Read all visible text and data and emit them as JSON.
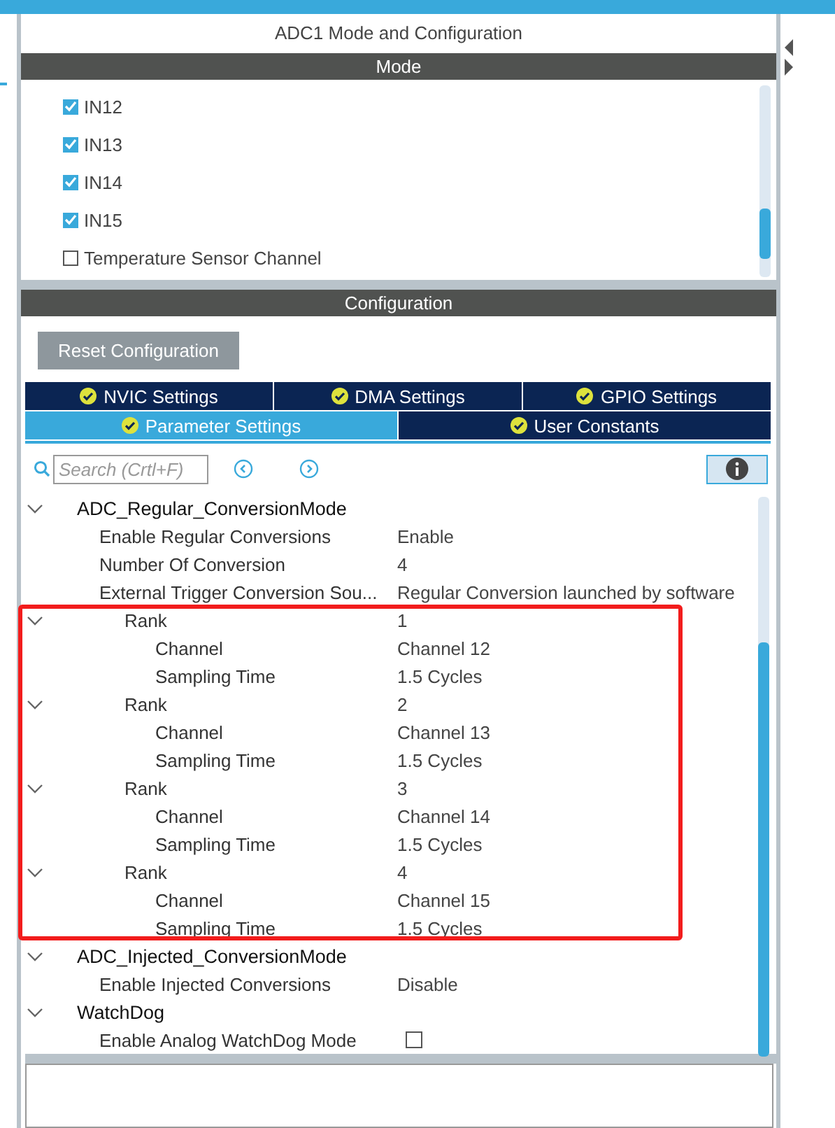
{
  "panel_title": "ADC1 Mode and Configuration",
  "mode": {
    "header": "Mode",
    "items": [
      {
        "label": "IN12",
        "checked": true
      },
      {
        "label": "IN13",
        "checked": true
      },
      {
        "label": "IN14",
        "checked": true
      },
      {
        "label": "IN15",
        "checked": true
      },
      {
        "label": "Temperature Sensor Channel",
        "checked": false
      }
    ]
  },
  "configuration": {
    "header": "Configuration",
    "reset_button": "Reset Configuration",
    "tab_rows": [
      [
        {
          "label": "NVIC Settings",
          "selected": false
        },
        {
          "label": "DMA Settings",
          "selected": false
        },
        {
          "label": "GPIO Settings",
          "selected": false
        }
      ],
      [
        {
          "label": "Parameter Settings",
          "selected": true
        },
        {
          "label": "User Constants",
          "selected": false
        }
      ]
    ],
    "search": {
      "placeholder": "Search (Crtl+F)"
    },
    "tree": [
      {
        "label": "ADC_Regular_ConversionMode",
        "expanded": true,
        "children": [
          {
            "label": "Enable Regular Conversions",
            "value": "Enable"
          },
          {
            "label": "Number Of Conversion",
            "value": "4"
          },
          {
            "label": "External Trigger Conversion Sou...",
            "value": "Regular Conversion launched by software"
          },
          {
            "label": "Rank",
            "value": "1",
            "expanded": true,
            "children": [
              {
                "label": "Channel",
                "value": "Channel 12"
              },
              {
                "label": "Sampling Time",
                "value": "1.5 Cycles"
              }
            ]
          },
          {
            "label": "Rank",
            "value": "2",
            "expanded": true,
            "children": [
              {
                "label": "Channel",
                "value": "Channel 13"
              },
              {
                "label": "Sampling Time",
                "value": "1.5 Cycles"
              }
            ]
          },
          {
            "label": "Rank",
            "value": "3",
            "expanded": true,
            "children": [
              {
                "label": "Channel",
                "value": "Channel 14"
              },
              {
                "label": "Sampling Time",
                "value": "1.5 Cycles"
              }
            ]
          },
          {
            "label": "Rank",
            "value": "4",
            "expanded": true,
            "children": [
              {
                "label": "Channel",
                "value": "Channel 15"
              },
              {
                "label": "Sampling Time",
                "value": "1.5 Cycles"
              }
            ]
          }
        ]
      },
      {
        "label": "ADC_Injected_ConversionMode",
        "expanded": true,
        "children": [
          {
            "label": "Enable Injected Conversions",
            "value": "Disable"
          }
        ]
      },
      {
        "label": "WatchDog",
        "expanded": true,
        "children": [
          {
            "label": "Enable Analog WatchDog Mode",
            "checked": false
          }
        ]
      }
    ]
  }
}
